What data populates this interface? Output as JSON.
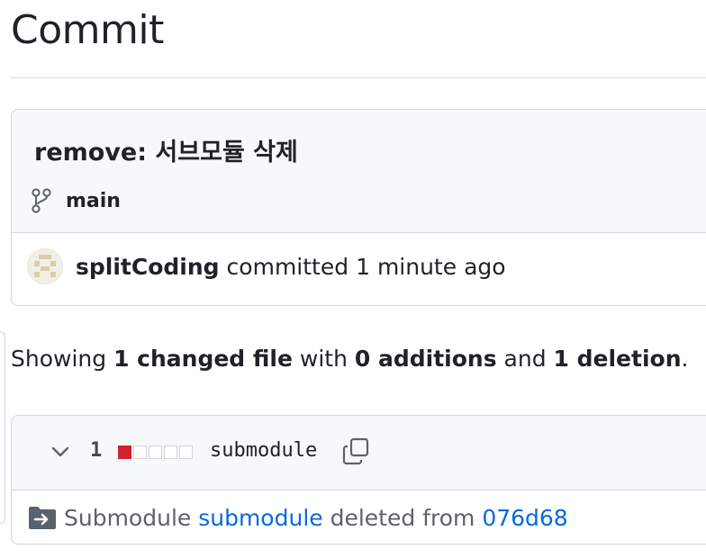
{
  "page": {
    "title": "Commit"
  },
  "commit": {
    "message": "remove: 서브모듈 삭제",
    "branch": "main",
    "author": "splitCoding",
    "verb": "committed",
    "time": "1 minute ago"
  },
  "summary": {
    "prefix": "Showing ",
    "changed": "1 changed file",
    "mid1": " with ",
    "additions": "0 additions",
    "mid2": " and ",
    "deletions": "1 deletion",
    "suffix": "."
  },
  "file": {
    "change_count": "1",
    "diffstat": {
      "deleted_blocks": 1,
      "neutral_blocks": 4
    },
    "name": "submodule",
    "sub_prefix": "Submodule ",
    "sub_link": "submodule",
    "sub_mid": " deleted from ",
    "sub_hash": "076d68"
  },
  "icons": {
    "branch": "git-branch-icon",
    "avatar": "identicon-avatar",
    "chevron": "chevron-down-icon",
    "copy": "copy-icon",
    "folder": "file-submodule-icon"
  },
  "colors": {
    "link": "#0969da",
    "deletion": "#cf222e",
    "border": "#d0d7de",
    "header_bg": "#f6f8fa"
  }
}
